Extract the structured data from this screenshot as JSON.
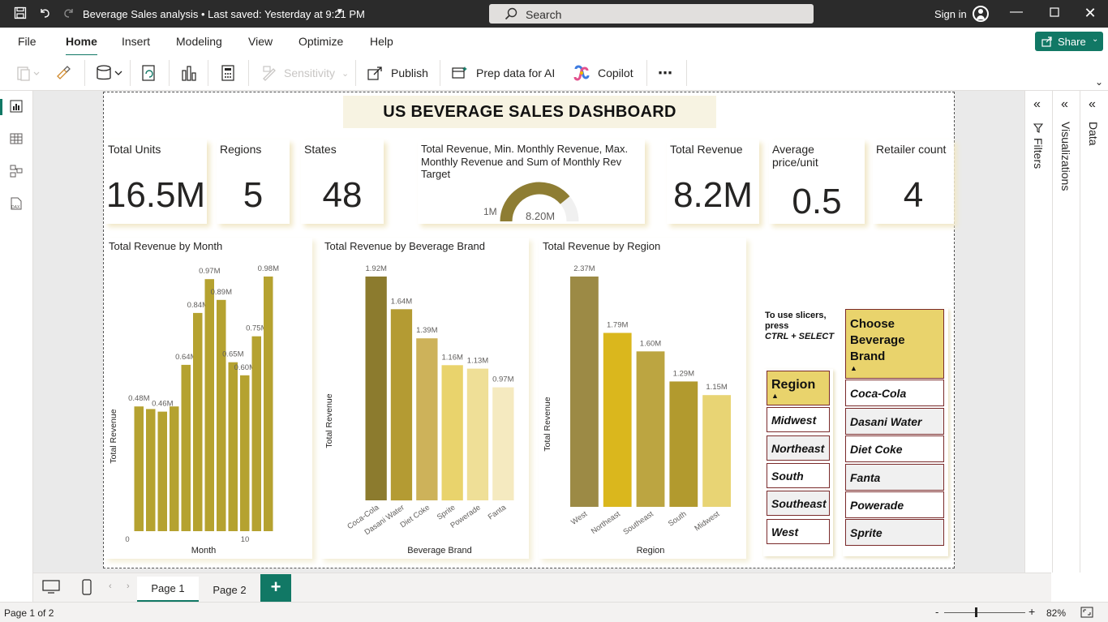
{
  "titlebar": {
    "doc_title": "Beverage Sales analysis • Last saved: Yesterday at 9:21 PM",
    "search_placeholder": "Search",
    "sign_in": "Sign in"
  },
  "menu": {
    "items": [
      "File",
      "Home",
      "Insert",
      "Modeling",
      "View",
      "Optimize",
      "Help"
    ],
    "active": "Home",
    "share": "Share"
  },
  "ribbon": {
    "sensitivity": "Sensitivity",
    "publish": "Publish",
    "prep_data": "Prep data for AI",
    "copilot": "Copilot",
    "more": "⋯"
  },
  "dashboard": {
    "title": "US BEVERAGE SALES DASHBOARD",
    "cards": [
      {
        "label": "Total Units",
        "value": "16.5M"
      },
      {
        "label": "Regions",
        "value": "5"
      },
      {
        "label": "States",
        "value": "48"
      },
      {
        "label": "Total Revenue",
        "value": "8.2M"
      },
      {
        "label": "Average price/unit",
        "value": "0.5"
      },
      {
        "label": "Retailer count",
        "value": "4"
      }
    ],
    "gauge": {
      "label": "Total Revenue, Min. Monthly Revenue, Max. Monthly Revenue and Sum of Monthly Rev Target",
      "min_label": "1M",
      "value_label": "8.20M",
      "fill_fraction": 0.78
    },
    "slicer_hint": {
      "line1": "To use slicers,",
      "line2": "press",
      "line3": "CTRL + SELECT"
    },
    "region_slicer": {
      "header": "Region",
      "items": [
        "Midwest",
        "Northeast",
        "South",
        "Southeast",
        "West"
      ]
    },
    "brand_slicer": {
      "header": "Choose Beverage Brand",
      "items": [
        "Coca-Cola",
        "Dasani Water",
        "Diet Coke",
        "Fanta",
        "Powerade",
        "Sprite"
      ]
    }
  },
  "chart_data": [
    {
      "type": "bar",
      "title": "Total Revenue by Month",
      "xlabel": "Month",
      "ylabel": "Total Revenue",
      "x": [
        1,
        2,
        3,
        4,
        5,
        6,
        7,
        8,
        9,
        10,
        11,
        12
      ],
      "values": [
        0.48,
        0.47,
        0.46,
        0.48,
        0.64,
        0.84,
        0.97,
        0.89,
        0.65,
        0.6,
        0.75,
        0.98
      ],
      "labels": [
        "0.48M",
        "",
        "0.46M",
        "",
        "0.64M",
        "0.84M",
        "0.97M",
        "0.89M",
        "0.65M",
        "0.60M",
        "0.75M",
        "0.98M"
      ],
      "x_ticks": [
        "0",
        "10"
      ],
      "color": "#b5a230"
    },
    {
      "type": "bar",
      "title": "Total Revenue by Beverage Brand",
      "xlabel": "Beverage Brand",
      "ylabel": "Total Revenue",
      "categories": [
        "Coca-Cola",
        "Dasani Water",
        "Diet Coke",
        "Sprite",
        "Powerade",
        "Fanta"
      ],
      "values": [
        1.92,
        1.64,
        1.39,
        1.16,
        1.13,
        0.97
      ],
      "labels": [
        "1.92M",
        "1.64M",
        "1.39M",
        "1.16M",
        "1.13M",
        "0.97M"
      ],
      "colors": [
        "#8c7b2e",
        "#b49b33",
        "#cdb25a",
        "#e9d36c",
        "#efdf97",
        "#f5eac0"
      ]
    },
    {
      "type": "bar",
      "title": "Total Revenue by Region",
      "xlabel": "Region",
      "ylabel": "Total Revenue",
      "categories": [
        "West",
        "Northeast",
        "Southeast",
        "South",
        "Midwest"
      ],
      "values": [
        2.37,
        1.79,
        1.6,
        1.29,
        1.15
      ],
      "labels": [
        "2.37M",
        "1.79M",
        "1.60M",
        "1.29M",
        "1.15M"
      ],
      "colors": [
        "#9c8a45",
        "#dab71d",
        "#bca541",
        "#b29a2e",
        "#e8d474"
      ]
    }
  ],
  "pages": {
    "tabs": [
      "Page 1",
      "Page 2"
    ],
    "active": "Page 1",
    "add": "+"
  },
  "status": {
    "page_info": "Page 1 of 2",
    "zoom": "82%"
  },
  "panes": {
    "filters": "Filters",
    "visualizations": "Visualizations",
    "data": "Data"
  }
}
